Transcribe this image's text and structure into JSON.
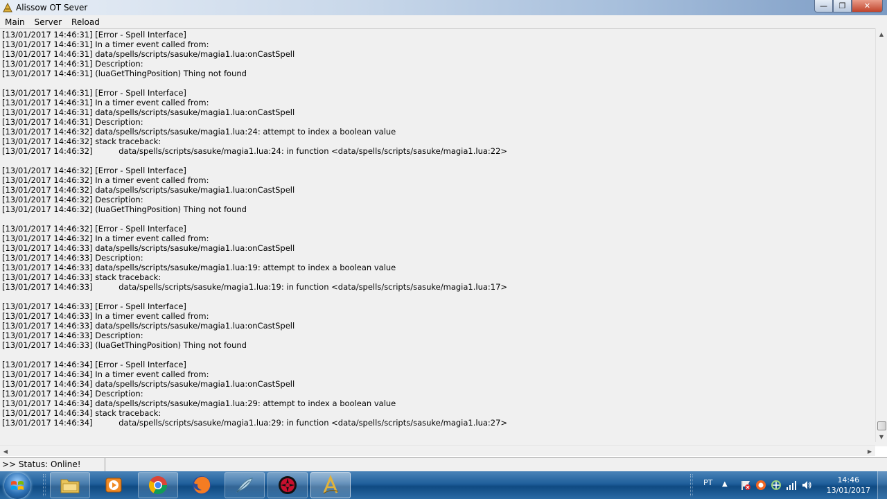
{
  "window": {
    "title": "Alissow OT Sever",
    "controls": {
      "minimize": "—",
      "maximize": "❐",
      "close": "✕"
    }
  },
  "menu": {
    "items": [
      "Main",
      "Server",
      "Reload"
    ]
  },
  "log": {
    "lines": [
      {
        "ts": "[13/01/2017 14:46:31]",
        "msg": "[Error - Spell Interface]"
      },
      {
        "ts": "[13/01/2017 14:46:31]",
        "msg": "In a timer event called from:"
      },
      {
        "ts": "[13/01/2017 14:46:31]",
        "msg": "data/spells/scripts/sasuke/magia1.lua:onCastSpell"
      },
      {
        "ts": "[13/01/2017 14:46:31]",
        "msg": "Description:"
      },
      {
        "ts": "[13/01/2017 14:46:31]",
        "msg": "(luaGetThingPosition) Thing not found"
      },
      {
        "ts": "",
        "msg": ""
      },
      {
        "ts": "[13/01/2017 14:46:31]",
        "msg": "[Error - Spell Interface]"
      },
      {
        "ts": "[13/01/2017 14:46:31]",
        "msg": "In a timer event called from:"
      },
      {
        "ts": "[13/01/2017 14:46:31]",
        "msg": "data/spells/scripts/sasuke/magia1.lua:onCastSpell"
      },
      {
        "ts": "[13/01/2017 14:46:31]",
        "msg": "Description:"
      },
      {
        "ts": "[13/01/2017 14:46:32]",
        "msg": "data/spells/scripts/sasuke/magia1.lua:24: attempt to index a boolean value"
      },
      {
        "ts": "[13/01/2017 14:46:32]",
        "msg": "stack traceback:"
      },
      {
        "ts": "[13/01/2017 14:46:32]",
        "msg": "data/spells/scripts/sasuke/magia1.lua:24: in function <data/spells/scripts/sasuke/magia1.lua:22>",
        "indent": true
      },
      {
        "ts": "",
        "msg": ""
      },
      {
        "ts": "[13/01/2017 14:46:32]",
        "msg": "[Error - Spell Interface]"
      },
      {
        "ts": "[13/01/2017 14:46:32]",
        "msg": "In a timer event called from:"
      },
      {
        "ts": "[13/01/2017 14:46:32]",
        "msg": "data/spells/scripts/sasuke/magia1.lua:onCastSpell"
      },
      {
        "ts": "[13/01/2017 14:46:32]",
        "msg": "Description:"
      },
      {
        "ts": "[13/01/2017 14:46:32]",
        "msg": "(luaGetThingPosition) Thing not found"
      },
      {
        "ts": "",
        "msg": ""
      },
      {
        "ts": "[13/01/2017 14:46:32]",
        "msg": "[Error - Spell Interface]"
      },
      {
        "ts": "[13/01/2017 14:46:32]",
        "msg": "In a timer event called from:"
      },
      {
        "ts": "[13/01/2017 14:46:33]",
        "msg": "data/spells/scripts/sasuke/magia1.lua:onCastSpell"
      },
      {
        "ts": "[13/01/2017 14:46:33]",
        "msg": "Description:"
      },
      {
        "ts": "[13/01/2017 14:46:33]",
        "msg": "data/spells/scripts/sasuke/magia1.lua:19: attempt to index a boolean value"
      },
      {
        "ts": "[13/01/2017 14:46:33]",
        "msg": "stack traceback:"
      },
      {
        "ts": "[13/01/2017 14:46:33]",
        "msg": "data/spells/scripts/sasuke/magia1.lua:19: in function <data/spells/scripts/sasuke/magia1.lua:17>",
        "indent": true
      },
      {
        "ts": "",
        "msg": ""
      },
      {
        "ts": "[13/01/2017 14:46:33]",
        "msg": "[Error - Spell Interface]"
      },
      {
        "ts": "[13/01/2017 14:46:33]",
        "msg": "In a timer event called from:"
      },
      {
        "ts": "[13/01/2017 14:46:33]",
        "msg": "data/spells/scripts/sasuke/magia1.lua:onCastSpell"
      },
      {
        "ts": "[13/01/2017 14:46:33]",
        "msg": "Description:"
      },
      {
        "ts": "[13/01/2017 14:46:33]",
        "msg": "(luaGetThingPosition) Thing not found"
      },
      {
        "ts": "",
        "msg": ""
      },
      {
        "ts": "[13/01/2017 14:46:34]",
        "msg": "[Error - Spell Interface]"
      },
      {
        "ts": "[13/01/2017 14:46:34]",
        "msg": "In a timer event called from:"
      },
      {
        "ts": "[13/01/2017 14:46:34]",
        "msg": "data/spells/scripts/sasuke/magia1.lua:onCastSpell"
      },
      {
        "ts": "[13/01/2017 14:46:34]",
        "msg": "Description:"
      },
      {
        "ts": "[13/01/2017 14:46:34]",
        "msg": "data/spells/scripts/sasuke/magia1.lua:29: attempt to index a boolean value"
      },
      {
        "ts": "[13/01/2017 14:46:34]",
        "msg": "stack traceback:"
      },
      {
        "ts": "[13/01/2017 14:46:34]",
        "msg": "data/spells/scripts/sasuke/magia1.lua:29: in function <data/spells/scripts/sasuke/magia1.lua:27>",
        "indent": true
      }
    ]
  },
  "status": {
    "text": ">> Status: Online!"
  },
  "taskbar": {
    "apps": [
      {
        "name": "start-orb",
        "icon": "windows-logo-icon"
      },
      {
        "name": "file-explorer",
        "icon": "folder-icon"
      },
      {
        "name": "media-player",
        "icon": "media-player-icon"
      },
      {
        "name": "chrome",
        "icon": "chrome-icon"
      },
      {
        "name": "firefox",
        "icon": "firefox-icon"
      },
      {
        "name": "app-feather",
        "icon": "feather-icon"
      },
      {
        "name": "app-sharingan",
        "icon": "sharingan-icon"
      },
      {
        "name": "alissow-ot",
        "icon": "alissow-icon"
      }
    ],
    "language": "PT",
    "tray_arrow": "▲",
    "clock": {
      "time": "14:46",
      "date": "13/01/2017"
    }
  }
}
